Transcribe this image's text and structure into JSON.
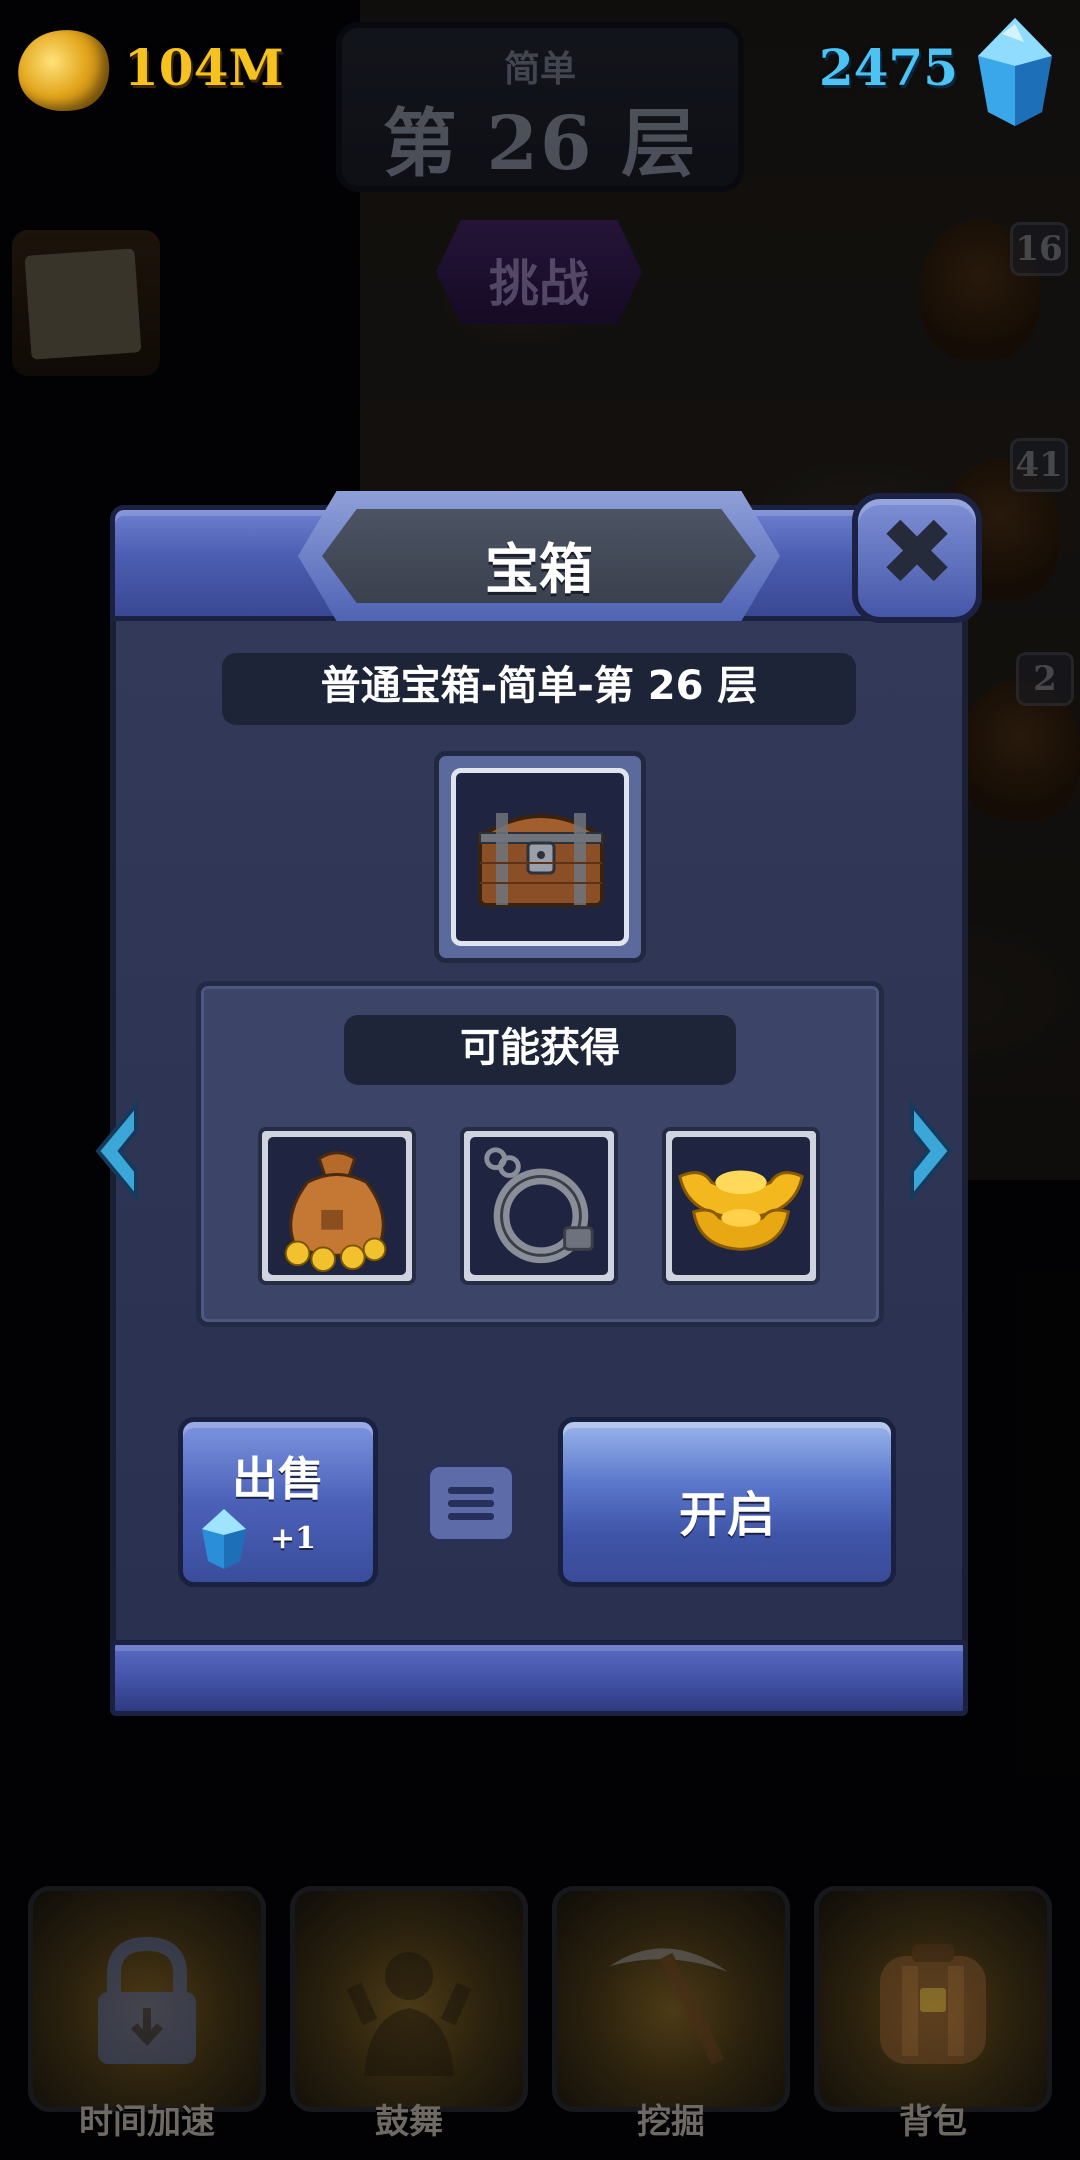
{
  "hud": {
    "gold_amount": "104M",
    "gem_amount": "2475",
    "floor_difficulty": "简单",
    "floor_label": "第 26 层",
    "challenge_label": "挑战",
    "side_levels": [
      "16",
      "41",
      "2"
    ]
  },
  "dialog": {
    "title": "宝箱",
    "chest_name": "普通宝箱-简单-第 26 层",
    "rewards_title": "可能获得",
    "rewards": [
      {
        "name": "gold-coin-bag-icon"
      },
      {
        "name": "handcuff-icon"
      },
      {
        "name": "gold-ingot-icon"
      }
    ],
    "sell_label": "出售",
    "sell_amount": "+1",
    "open_label": "开启"
  },
  "nav": {
    "items": [
      {
        "label": "时间加速",
        "icon": "lock-icon"
      },
      {
        "label": "鼓舞",
        "icon": "cheer-icon"
      },
      {
        "label": "挖掘",
        "icon": "pickaxe-icon"
      },
      {
        "label": "背包",
        "icon": "backpack-icon"
      }
    ]
  },
  "colors": {
    "gold_text": "#f6c21f",
    "gem_text": "#4cc3f3",
    "dialog_frame": "#4b5db0",
    "dialog_body": "#2e3454"
  }
}
